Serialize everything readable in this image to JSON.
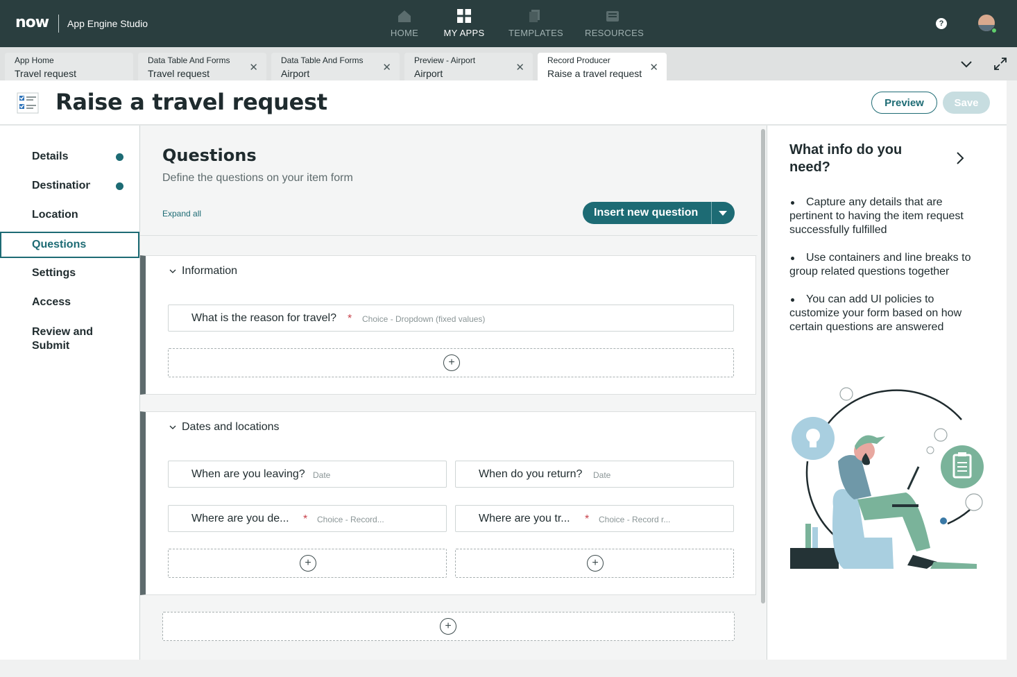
{
  "topbar": {
    "logo": "now",
    "app_title": "App Engine Studio",
    "nav": [
      {
        "label": "HOME",
        "icon": "home-icon"
      },
      {
        "label": "MY APPS",
        "icon": "grid-icon"
      },
      {
        "label": "TEMPLATES",
        "icon": "templates-icon"
      },
      {
        "label": "RESOURCES",
        "icon": "resources-icon"
      }
    ],
    "help": "?",
    "active_nav": "MY APPS"
  },
  "tabs": [
    {
      "line1": "App Home",
      "line2": "Travel request",
      "closable": false
    },
    {
      "line1": "Data Table And Forms",
      "line2": "Travel request",
      "closable": true
    },
    {
      "line1": "Data Table And Forms",
      "line2": "Airport",
      "closable": true
    },
    {
      "line1": "Preview - Airport",
      "line2": "Airport",
      "closable": true
    },
    {
      "line1": "Record Producer",
      "line2": "Raise a travel request",
      "closable": true
    }
  ],
  "page": {
    "title": "Raise a travel request",
    "preview_label": "Preview",
    "save_label": "Save"
  },
  "leftnav": [
    {
      "label": "Details",
      "dot": true
    },
    {
      "label": "Destination",
      "dot": true
    },
    {
      "label": "Location",
      "dot": false
    },
    {
      "label": "Questions",
      "dot": false
    },
    {
      "label": "Settings",
      "dot": false
    },
    {
      "label": "Access",
      "dot": false
    },
    {
      "label": "Review and Submit",
      "dot": false
    }
  ],
  "main": {
    "title": "Questions",
    "subtitle": "Define the questions on your item form",
    "expand_all": "Expand all",
    "insert_label": "Insert new question",
    "sections": [
      {
        "title": "Information",
        "questions": [
          {
            "label": "What is the reason for travel?",
            "required": true,
            "type": "Choice - Dropdown (fixed values)"
          }
        ]
      },
      {
        "title": "Dates and locations",
        "questions": [
          {
            "label": "When are you leaving?",
            "required": false,
            "type": "Date"
          },
          {
            "label": "When do you return?",
            "required": false,
            "type": "Date"
          },
          {
            "label": "Where are you de...",
            "required": true,
            "type": "Choice - Record..."
          },
          {
            "label": "Where are you tr...",
            "required": true,
            "type": "Choice - Record r..."
          }
        ]
      }
    ],
    "required_mark": "*",
    "plus": "+"
  },
  "help_panel": {
    "title": "What info do you need?",
    "tips": [
      "Capture any details that are pertinent to having the item request successfully fulfilled",
      "Use containers and line breaks to group related questions together",
      "You can add UI policies to customize your form based on how certain questions are answered"
    ]
  },
  "colors": {
    "topbar": "#2a3e3f",
    "accent": "#1d6b74",
    "required": "#c8424b",
    "illustration_green": "#7ab39a",
    "illustration_blue": "#a9cfe0"
  }
}
